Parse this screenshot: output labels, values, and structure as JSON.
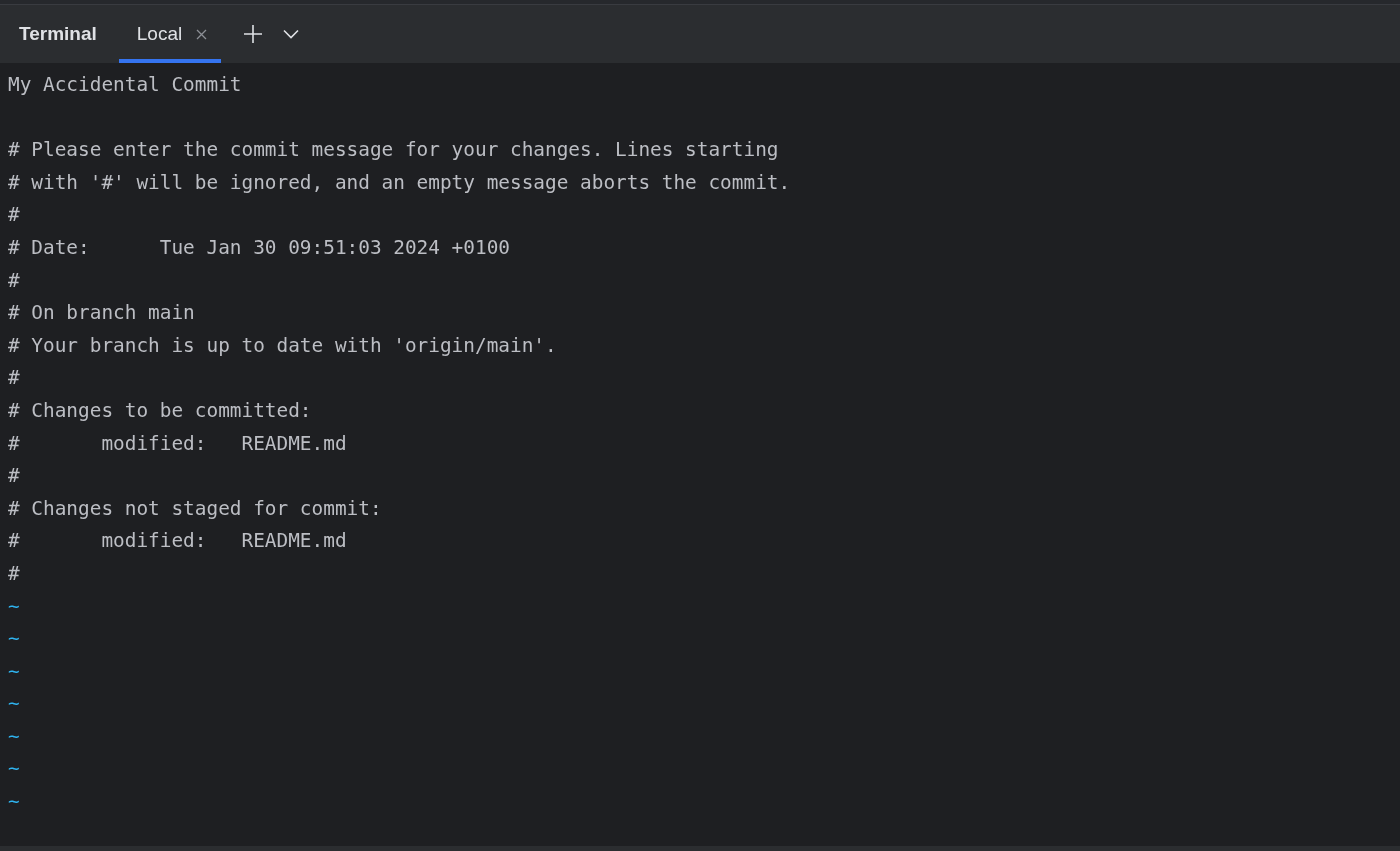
{
  "panel": {
    "title": "Terminal"
  },
  "tabs": [
    {
      "label": "Local",
      "selected": true
    }
  ],
  "lines": [
    {
      "kind": "text",
      "text": "My Accidental Commit"
    },
    {
      "kind": "blank"
    },
    {
      "kind": "text",
      "text": "# Please enter the commit message for your changes. Lines starting"
    },
    {
      "kind": "text",
      "text": "# with '#' will be ignored, and an empty message aborts the commit."
    },
    {
      "kind": "text",
      "text": "#"
    },
    {
      "kind": "text",
      "text": "# Date:      Tue Jan 30 09:51:03 2024 +0100"
    },
    {
      "kind": "text",
      "text": "#"
    },
    {
      "kind": "text",
      "text": "# On branch main"
    },
    {
      "kind": "text",
      "text": "# Your branch is up to date with 'origin/main'."
    },
    {
      "kind": "text",
      "text": "#"
    },
    {
      "kind": "text",
      "text": "# Changes to be committed:"
    },
    {
      "kind": "text",
      "text": "#       modified:   README.md"
    },
    {
      "kind": "text",
      "text": "#"
    },
    {
      "kind": "text",
      "text": "# Changes not staged for commit:"
    },
    {
      "kind": "text",
      "text": "#       modified:   README.md"
    },
    {
      "kind": "text",
      "text": "#"
    },
    {
      "kind": "empty",
      "text": "~"
    },
    {
      "kind": "empty",
      "text": "~"
    },
    {
      "kind": "empty",
      "text": "~"
    },
    {
      "kind": "empty",
      "text": "~"
    },
    {
      "kind": "empty",
      "text": "~"
    },
    {
      "kind": "empty",
      "text": "~"
    },
    {
      "kind": "empty",
      "text": "~"
    }
  ]
}
